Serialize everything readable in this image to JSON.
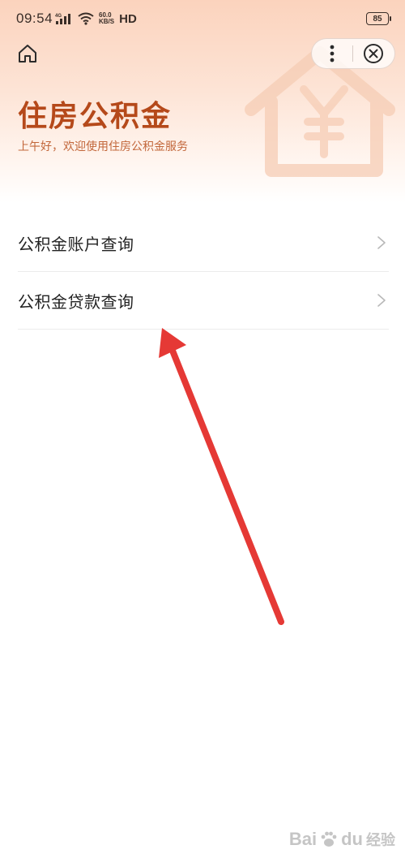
{
  "status_bar": {
    "time": "09:54",
    "network_type": "4G",
    "net_speed_value": "60.0",
    "net_speed_unit": "KB/S",
    "hd_label": "HD",
    "battery_level": "85"
  },
  "nav": {
    "home_icon": "home-icon",
    "more_icon": "more-vertical-icon",
    "close_icon": "close-circle-icon"
  },
  "header": {
    "title": "住房公积金",
    "subtitle": "上午好，欢迎使用住房公积金服务",
    "watermark_icon": "house-yen-icon"
  },
  "menu": {
    "items": [
      {
        "label": "公积金账户查询",
        "icon": "chevron-right-icon"
      },
      {
        "label": "公积金贷款查询",
        "icon": "chevron-right-icon"
      }
    ]
  },
  "watermark": {
    "brand": "Bai",
    "brand_suffix": "du",
    "sub": "经验"
  },
  "colors": {
    "accent": "#b5491a",
    "subtitle": "#c2673b",
    "header_gradient_top": "#fbd3bd",
    "annotation_arrow": "#e53935"
  }
}
